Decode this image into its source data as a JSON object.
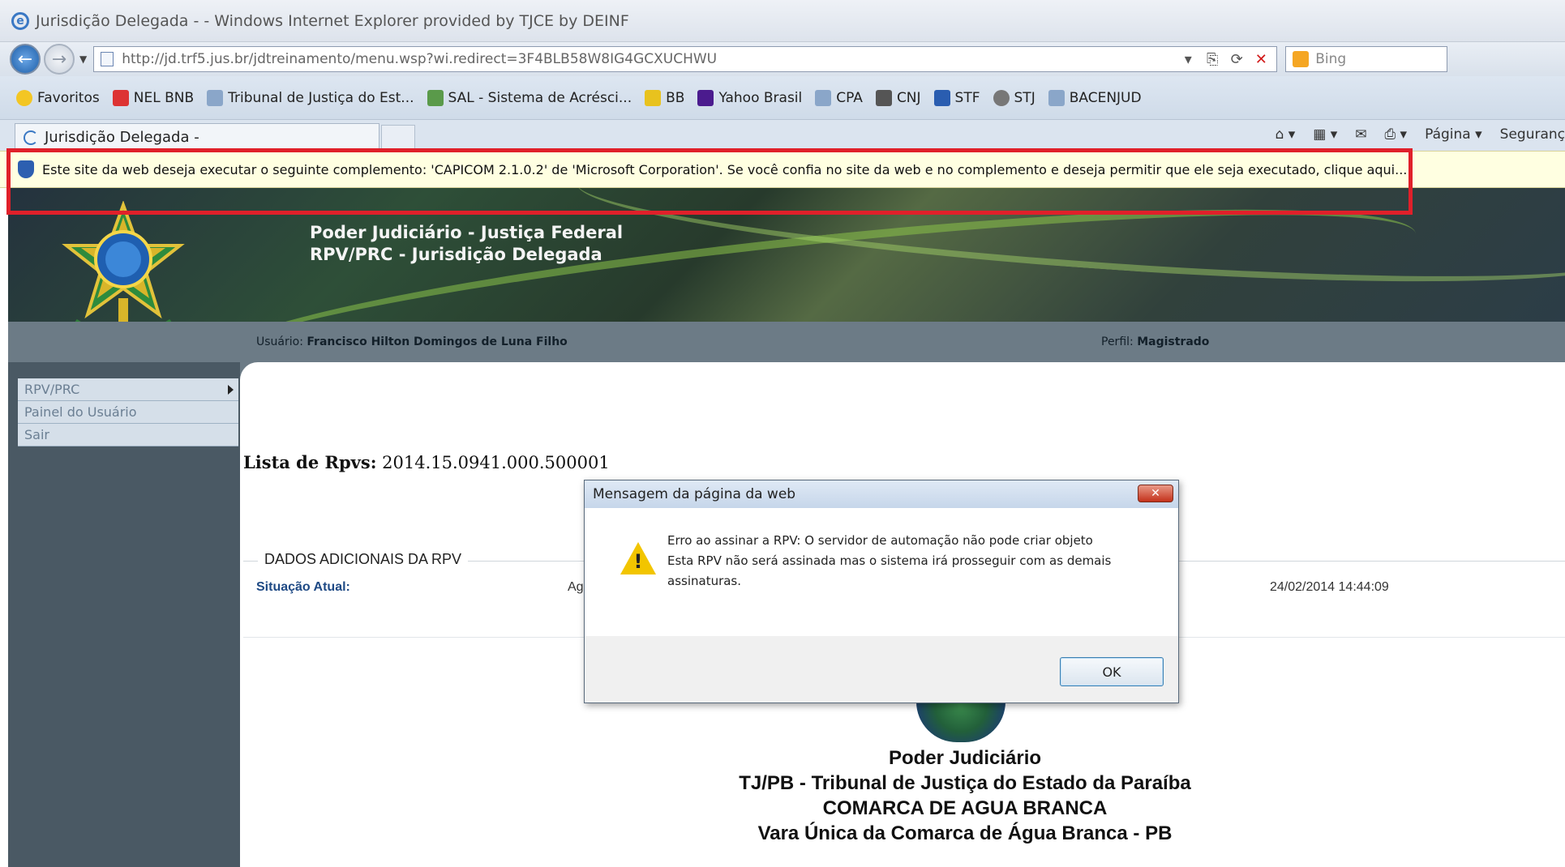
{
  "browser": {
    "window_title": "Jurisdição Delegada - - Windows Internet Explorer provided by TJCE by DEINF",
    "url": "http://jd.trf5.jus.br/jdtreinamento/menu.wsp?wi.redirect=3F4BLB58W8IG4GCXUCHWU",
    "search_placeholder": "Bing",
    "favorites_label": "Favoritos",
    "favorites": [
      "NEL BNB",
      "Tribunal de Justiça do Est...",
      "SAL - Sistema de Acrésci...",
      "BB",
      "Yahoo Brasil",
      "CPA",
      "CNJ",
      "STF",
      "STJ",
      "BACENJUD"
    ],
    "tab_title": "Jurisdição Delegada -",
    "commands": {
      "pagina": "Página ▾",
      "seguranca": "Seguranç"
    },
    "infobar_text": "Este site da web deseja executar o seguinte complemento: 'CAPICOM 2.1.0.2' de 'Microsoft Corporation'. Se você confia no site da web e no complemento e deseja permitir que ele seja executado, clique aqui...",
    "colors": {
      "highlight": "#e0202a",
      "infobar_bg": "#ffffe1"
    }
  },
  "header": {
    "line1": "Poder Judiciário - Justiça Federal",
    "line2": "RPV/PRC - Jurisdição Delegada"
  },
  "userbar": {
    "user_label": "Usuário:",
    "user_name": "Francisco Hilton Domingos de Luna Filho",
    "profile_label": "Perfil:",
    "profile_name": "Magistrado"
  },
  "menu": {
    "items": [
      {
        "label": "RPV/PRC"
      },
      {
        "label": "Painel do Usuário"
      },
      {
        "label": "Sair"
      }
    ]
  },
  "main": {
    "list_label": "Lista de Rpvs:",
    "list_value": "2014.15.0941.000.500001",
    "section_title": "DADOS ADICIONAIS DA RPV",
    "status_label": "Situação Atual:",
    "status_value": "Ag",
    "status_date": "24/02/2014 14:44:09"
  },
  "footer": {
    "line1": "Poder Judiciário",
    "line2": "TJ/PB - Tribunal de Justiça do Estado da Paraíba",
    "line3": "COMARCA DE AGUA BRANCA",
    "line4": "Vara Única da Comarca de Água Branca - PB"
  },
  "dialog": {
    "title": "Mensagem da página da web",
    "message_line1": "Erro ao assinar a RPV: O servidor de automação não pode criar objeto",
    "message_line2": " Esta RPV não será assinada mas o sistema irá prosseguir com as demais assinaturas.",
    "ok_label": "OK",
    "icon": "warning-icon"
  }
}
